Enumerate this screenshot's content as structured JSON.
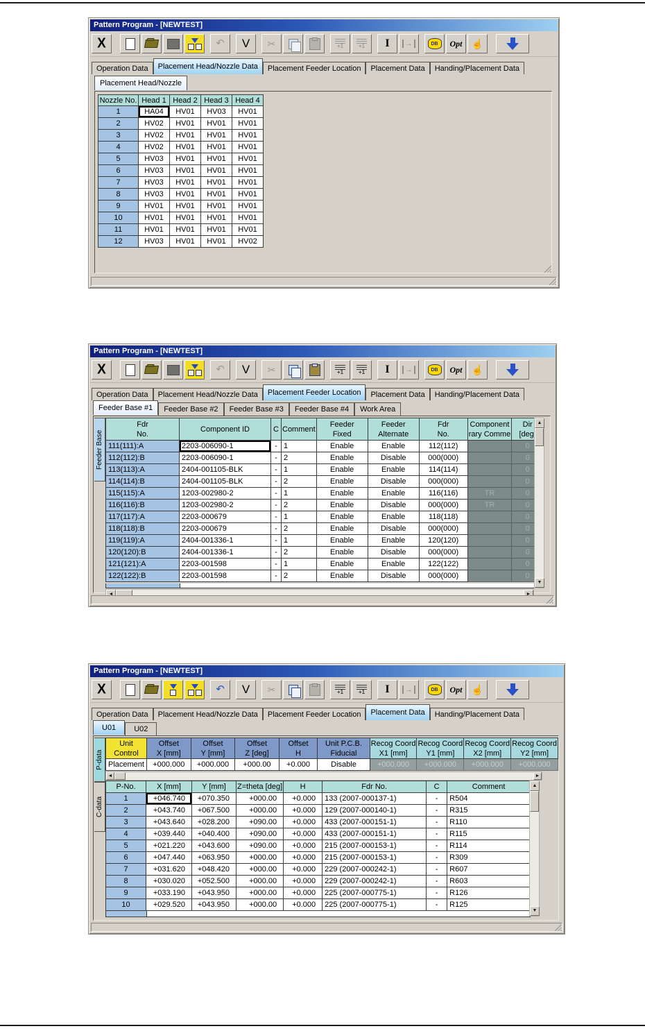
{
  "window_title": "Pattern Program - [NEWTEST]",
  "toolbar": {
    "close_label": "X",
    "verify_label": "V",
    "insert_label": "I",
    "plus_one_label": "+1",
    "db_label": "DB",
    "opt_label": "Opt"
  },
  "icons": {
    "up_arrow": "▲",
    "down_arrow": "▼",
    "left_arrow": "◄",
    "right_arrow": "►",
    "undo": "↶",
    "cut": "✂",
    "hand": "☝",
    "jump_right": "→"
  },
  "main_tabs": [
    "Operation Data",
    "Placement Head/Nozzle Data",
    "Placement Feeder Location",
    "Placement Data",
    "Handing/Placement Data"
  ],
  "window1": {
    "subtab": "Placement Head/Nozzle",
    "table": {
      "headers": [
        "Nozzle No.",
        "Head 1",
        "Head 2",
        "Head 3",
        "Head 4"
      ],
      "rows": [
        [
          "1",
          "HA04",
          "HV01",
          "HV03",
          "HV01"
        ],
        [
          "2",
          "HV02",
          "HV01",
          "HV01",
          "HV01"
        ],
        [
          "3",
          "HV02",
          "HV01",
          "HV01",
          "HV01"
        ],
        [
          "4",
          "HV02",
          "HV01",
          "HV01",
          "HV01"
        ],
        [
          "5",
          "HV03",
          "HV01",
          "HV01",
          "HV01"
        ],
        [
          "6",
          "HV03",
          "HV01",
          "HV01",
          "HV01"
        ],
        [
          "7",
          "HV03",
          "HV01",
          "HV01",
          "HV01"
        ],
        [
          "8",
          "HV03",
          "HV01",
          "HV01",
          "HV01"
        ],
        [
          "9",
          "HV01",
          "HV01",
          "HV01",
          "HV01"
        ],
        [
          "10",
          "HV01",
          "HV01",
          "HV01",
          "HV01"
        ],
        [
          "11",
          "HV01",
          "HV01",
          "HV01",
          "HV01"
        ],
        [
          "12",
          "HV03",
          "HV01",
          "HV01",
          "HV02"
        ]
      ]
    }
  },
  "window2": {
    "side_tab": "Feeder Base",
    "subtabs": [
      "Feeder Base #1",
      "Feeder Base #2",
      "Feeder Base #3",
      "Feeder Base #4",
      "Work Area"
    ],
    "table": {
      "headers": [
        [
          "Fdr",
          "No."
        ],
        [
          "Component ID",
          ""
        ],
        [
          "C",
          ""
        ],
        [
          "Comment",
          ""
        ],
        [
          "Feeder",
          "Fixed"
        ],
        [
          "Feeder",
          "Alternate"
        ],
        [
          "Fdr",
          "No."
        ],
        [
          "Component",
          "rary Comme"
        ],
        [
          "Dir",
          "[deg]"
        ]
      ],
      "rows": [
        [
          "111(111):A",
          "2203-006090-1",
          "-",
          "1",
          "Enable",
          "Enable",
          "112(112)",
          "",
          "0"
        ],
        [
          "112(112):B",
          "2203-006090-1",
          "-",
          "2",
          "Enable",
          "Disable",
          "000(000)",
          "",
          "0"
        ],
        [
          "113(113):A",
          "2404-001105-BLK",
          "-",
          "1",
          "Enable",
          "Enable",
          "114(114)",
          "",
          "0"
        ],
        [
          "114(114):B",
          "2404-001105-BLK",
          "-",
          "2",
          "Enable",
          "Disable",
          "000(000)",
          "",
          "0"
        ],
        [
          "115(115):A",
          "1203-002980-2",
          "-",
          "1",
          "Enable",
          "Enable",
          "116(116)",
          "TR",
          "0"
        ],
        [
          "116(116):B",
          "1203-002980-2",
          "-",
          "2",
          "Enable",
          "Disable",
          "000(000)",
          "TR",
          "0"
        ],
        [
          "117(117):A",
          "2203-000679",
          "-",
          "1",
          "Enable",
          "Enable",
          "118(118)",
          "",
          "0"
        ],
        [
          "118(118):B",
          "2203-000679",
          "-",
          "2",
          "Enable",
          "Disable",
          "000(000)",
          "",
          "0"
        ],
        [
          "119(119):A",
          "2404-001336-1",
          "-",
          "1",
          "Enable",
          "Enable",
          "120(120)",
          "",
          "0"
        ],
        [
          "120(120):B",
          "2404-001336-1",
          "-",
          "2",
          "Enable",
          "Disable",
          "000(000)",
          "",
          "0"
        ],
        [
          "121(121):A",
          "2203-001598",
          "-",
          "1",
          "Enable",
          "Enable",
          "122(122)",
          "",
          "0"
        ],
        [
          "122(122):B",
          "2203-001598",
          "-",
          "2",
          "Enable",
          "Disable",
          "000(000)",
          "",
          "0"
        ]
      ]
    }
  },
  "window3": {
    "subtabs": [
      "U01",
      "U02"
    ],
    "side_tabs": [
      "P-data",
      "C-data"
    ],
    "p_table": {
      "headers": [
        [
          "Unit",
          "Control"
        ],
        [
          "Offset",
          "X [mm]"
        ],
        [
          "Offset",
          "Y [mm]"
        ],
        [
          "Offset",
          "Z [deg]"
        ],
        [
          "Offset",
          "H"
        ],
        [
          "Unit P.C.B.",
          "Fiducial"
        ],
        [
          "Recog Coord",
          "X1 [mm]"
        ],
        [
          "Recog Coord",
          "Y1 [mm]"
        ],
        [
          "Recog Coord",
          "X2 [mm]"
        ],
        [
          "Recog Coord",
          "Y2 [mm]"
        ]
      ],
      "rows": [
        [
          "Placement",
          "+000.000",
          "+000.000",
          "+000.00",
          "+0.000",
          "Disable",
          "+000.000",
          "+000.000",
          "+000.000",
          "+000.000"
        ]
      ]
    },
    "c_table": {
      "headers": [
        "P-No.",
        "X [mm]",
        "Y [mm]",
        "Z=theta [deg]",
        "H",
        "Fdr No.",
        "C",
        "Comment"
      ],
      "rows": [
        [
          "1",
          "+046.740",
          "+070.350",
          "+000.00",
          "+0.000",
          "133 (2007-000137-1)",
          "-",
          "R504"
        ],
        [
          "2",
          "+043.740",
          "+067.500",
          "+000.00",
          "+0.000",
          "129 (2007-000140-1)",
          "-",
          "R315"
        ],
        [
          "3",
          "+043.640",
          "+028.200",
          "+090.00",
          "+0.000",
          "433 (2007-000151-1)",
          "-",
          "R110"
        ],
        [
          "4",
          "+039.440",
          "+040.400",
          "+090.00",
          "+0.000",
          "433 (2007-000151-1)",
          "-",
          "R115"
        ],
        [
          "5",
          "+021.220",
          "+043.600",
          "+090.00",
          "+0.000",
          "215 (2007-000153-1)",
          "-",
          "R114"
        ],
        [
          "6",
          "+047.440",
          "+063.950",
          "+000.00",
          "+0.000",
          "215 (2007-000153-1)",
          "-",
          "R309"
        ],
        [
          "7",
          "+031.620",
          "+048.420",
          "+000.00",
          "+0.000",
          "229 (2007-000242-1)",
          "-",
          "R607"
        ],
        [
          "8",
          "+030.020",
          "+052.500",
          "+000.00",
          "+0.000",
          "229 (2007-000242-1)",
          "-",
          "R603"
        ],
        [
          "9",
          "+033.190",
          "+043.950",
          "+000.00",
          "+0.000",
          "225 (2007-000775-1)",
          "-",
          "R126"
        ],
        [
          "10",
          "+029.520",
          "+043.950",
          "+000.00",
          "+0.000",
          "225 (2007-000775-1)",
          "-",
          "R125"
        ]
      ]
    }
  }
}
